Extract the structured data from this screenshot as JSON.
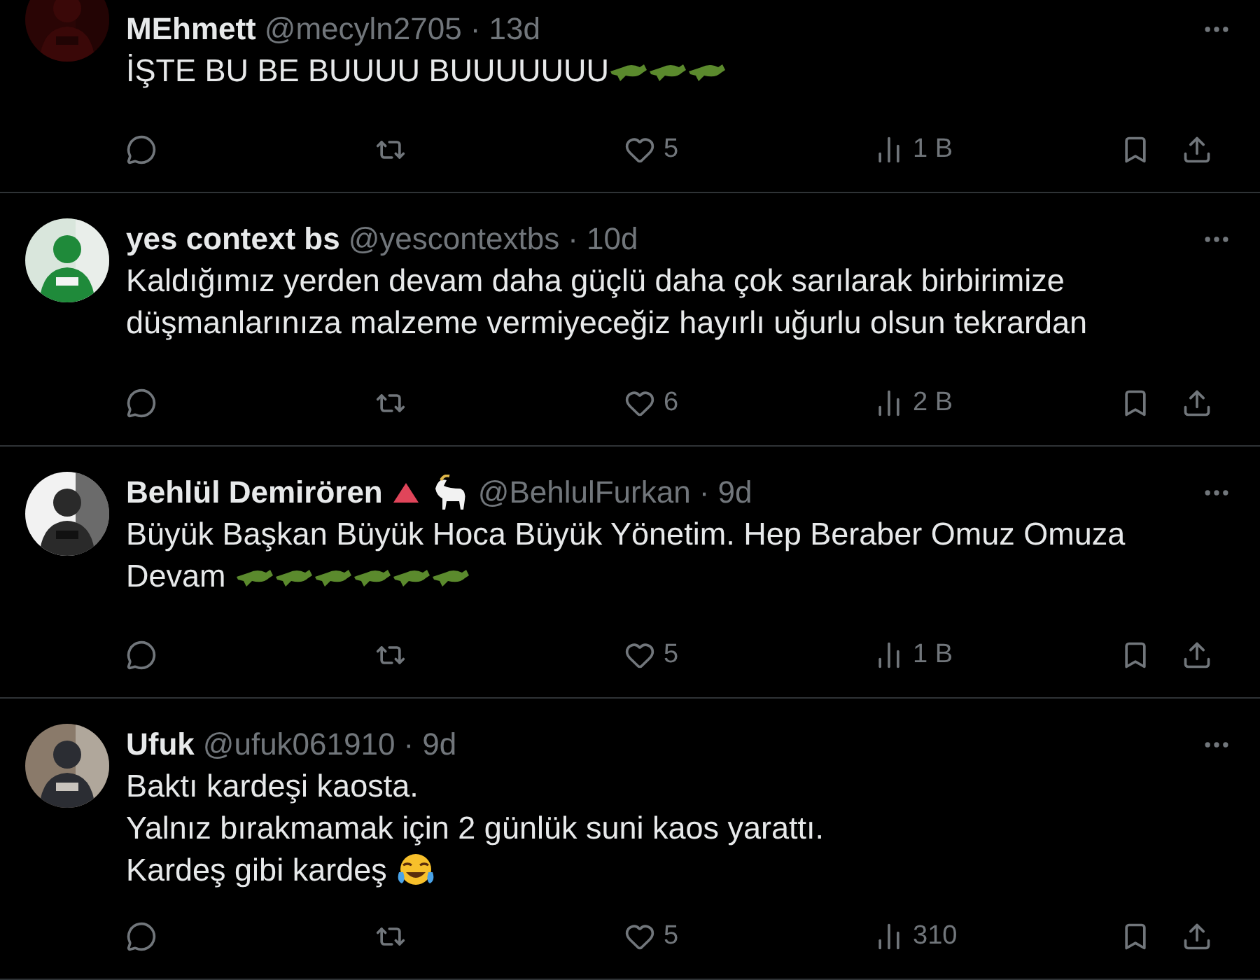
{
  "tweets": [
    {
      "name": "MEhmett",
      "handle": "@mecyln2705",
      "time": "· 13d",
      "body": [
        {
          "text": "İŞTE BU BE BUUUU BUUUUUUU",
          "emojis": [
            {
              "kind": "crocodile"
            },
            {
              "kind": "crocodile"
            },
            {
              "kind": "crocodile"
            }
          ]
        }
      ],
      "likes": "5",
      "views": "1 B"
    },
    {
      "name": "yes context bs",
      "handle": "@yescontextbs",
      "time": "· 10d",
      "body": [
        {
          "text": "Kaldığımız yerden devam daha güçlü daha çok sarılarak birbirimize"
        },
        {
          "text": "düşmanlarınıza malzeme vermiyeceğiz hayırlı uğurlu olsun tekrardan"
        }
      ],
      "likes": "6",
      "views": "2 B"
    },
    {
      "name": "Behlül Demirören",
      "badges": [
        {
          "kind": "triangle"
        },
        {
          "kind": "goat"
        }
      ],
      "handle": "@BehlulFurkan",
      "time": "· 9d",
      "body": [
        {
          "text": "Büyük Başkan Büyük Hoca Büyük Yönetim. Hep Beraber Omuz Omuza"
        },
        {
          "text": "Devam ",
          "emojis": [
            {
              "kind": "crocodile"
            },
            {
              "kind": "crocodile"
            },
            {
              "kind": "crocodile"
            },
            {
              "kind": "crocodile"
            },
            {
              "kind": "crocodile"
            },
            {
              "kind": "crocodile"
            }
          ]
        }
      ],
      "likes": "5",
      "views": "1 B"
    },
    {
      "name": "Ufuk",
      "handle": "@ufuk061910",
      "time": "· 9d",
      "body": [
        {
          "text": "Baktı kardeşi kaosta."
        },
        {
          "text": "Yalnız bırakmamak için 2 günlük suni kaos yarattı."
        },
        {
          "text": "Kardeş gibi kardeş ",
          "emojis": [
            {
              "kind": "laughing"
            }
          ]
        }
      ],
      "likes": "5",
      "views": "310"
    }
  ]
}
